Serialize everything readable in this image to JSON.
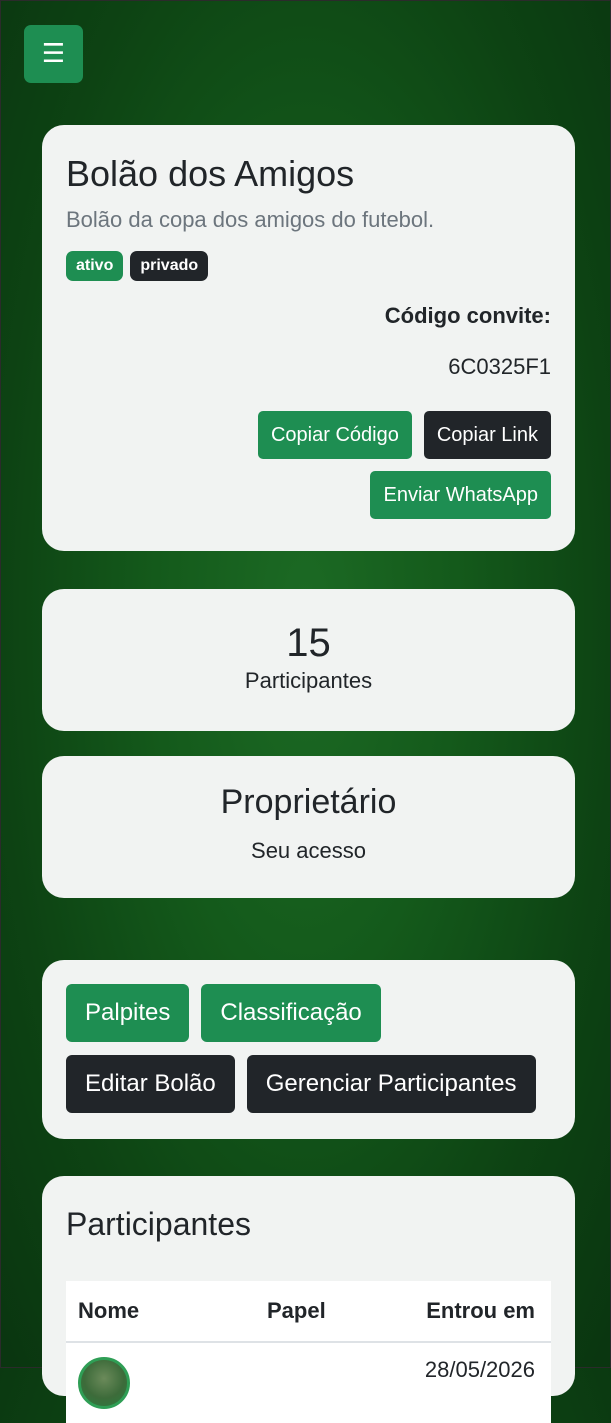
{
  "menu": {
    "icon": "menu-icon",
    "glyph": "☰"
  },
  "pool": {
    "title": "Bolão dos Amigos",
    "description": "Bolão da copa dos amigos do futebol.",
    "badges": [
      "ativo",
      "privado"
    ],
    "invite_label": "Código convite:",
    "invite_code": "6C0325F1",
    "buttons": {
      "copy_code": "Copiar Código",
      "copy_link": "Copiar Link",
      "whatsapp": "Enviar WhatsApp"
    }
  },
  "stats": {
    "participants_count": "15",
    "participants_label": "Participantes"
  },
  "role": {
    "title": "Proprietário",
    "subtitle": "Seu acesso"
  },
  "actions": {
    "predictions": "Palpites",
    "ranking": "Classificação",
    "edit_pool": "Editar Bolão",
    "manage_participants": "Gerenciar Participantes"
  },
  "participants": {
    "title": "Participantes",
    "columns": [
      "Nome",
      "Papel",
      "Entrou em"
    ],
    "rows": [
      {
        "name": "",
        "role": "",
        "joined": "28/05/2026"
      }
    ]
  },
  "colors": {
    "primary_green": "#1e8e52",
    "dark": "#212529",
    "card_bg": "#f1f3f2",
    "page_bg": "#145a1b"
  }
}
